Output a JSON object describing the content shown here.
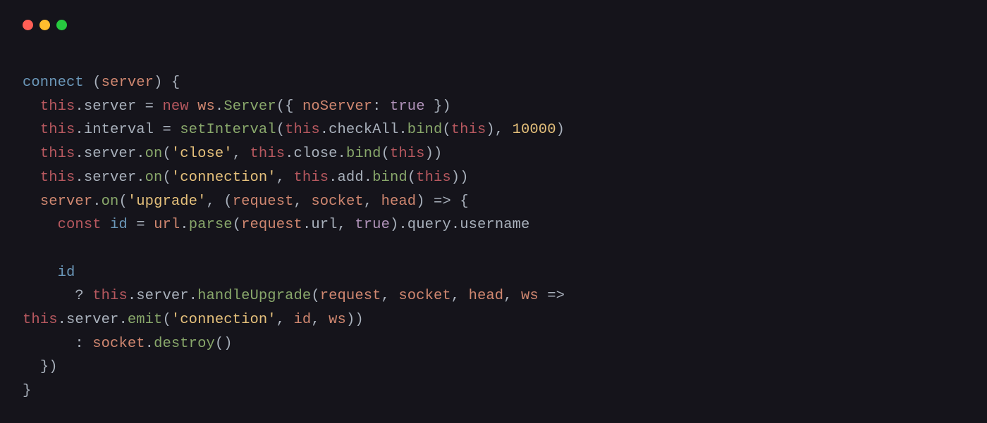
{
  "traffic_lights": {
    "red": "#ff5f56",
    "yellow": "#ffbd2e",
    "green": "#27c93f"
  },
  "code": {
    "fn_name": "connect",
    "param_server": "server",
    "this": "this",
    "prop_server": "server",
    "kw_new": "new",
    "ident_ws": "ws",
    "method_Server": "Server",
    "prop_noServer": "noServer",
    "bool_true": "true",
    "prop_interval": "interval",
    "method_setInterval": "setInterval",
    "prop_checkAll": "checkAll",
    "method_bind": "bind",
    "num_10000": "10000",
    "method_on": "on",
    "str_close": "'close'",
    "prop_close": "close",
    "str_connection": "'connection'",
    "prop_add": "add",
    "str_upgrade": "'upgrade'",
    "param_request": "request",
    "param_socket": "socket",
    "param_head": "head",
    "arrow": "=>",
    "kw_const": "const",
    "ident_id": "id",
    "ident_url": "url",
    "method_parse": "parse",
    "prop_url": "url",
    "prop_query": "query",
    "prop_username": "username",
    "method_handleUpgrade": "handleUpgrade",
    "method_emit": "emit",
    "method_destroy": "destroy",
    "q": "?",
    "colon": ":",
    "eq": "=",
    "dot": ".",
    "comma": ",",
    "sp": " ",
    "lp": "(",
    "rp": ")",
    "lb": "{",
    "rb": "}",
    "ind1": "  ",
    "ind2": "    ",
    "ind3": "      ",
    "ind3b": "      "
  }
}
